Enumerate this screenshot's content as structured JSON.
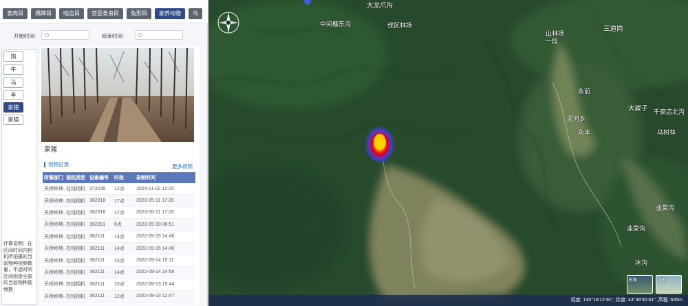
{
  "categories": {
    "tabs": [
      "食肉目",
      "偶蹄目",
      "啮齿目",
      "劳亚食虫目",
      "兔形目",
      "家养动物",
      "鸟"
    ],
    "active_index": 5
  },
  "filters": {
    "start_label": "开始时间:",
    "end_label": "结束时间:"
  },
  "animals": {
    "items": [
      "狗",
      "牛",
      "马",
      "羊",
      "家猪",
      "家猫"
    ],
    "active_index": 4
  },
  "calc_note": "计算说明：在区间时间内相机所拍摄的当前物种视频数量，不选时间区间则是全部的当前物种视频数",
  "detail": {
    "species_name": "家猪",
    "section_title": "视频记录",
    "more_link": "更多视频",
    "columns": [
      "所属部门",
      "相机类型",
      "设备编号",
      "时段",
      "录制时间"
    ],
    "rows": [
      {
        "dept": "天桥岭林...",
        "type": "在线相机",
        "device": "372035",
        "period": "12点",
        "time": "2024-11-02 12:00"
      },
      {
        "dept": "天桥岭林...",
        "type": "在线相机",
        "device": "382318",
        "period": "17点",
        "time": "2023-05-11 17:20"
      },
      {
        "dept": "天桥岭林...",
        "type": "在线相机",
        "device": "382318",
        "period": "17点",
        "time": "2023-05-11 17:20"
      },
      {
        "dept": "天桥岭林...",
        "type": "在线相机",
        "device": "382281",
        "period": "8点",
        "time": "2023-05-10 08:51"
      },
      {
        "dept": "天桥岭林...",
        "type": "在线相机",
        "device": "382111",
        "period": "14点",
        "time": "2022-09-15 14:48"
      },
      {
        "dept": "天桥岭林...",
        "type": "在线相机",
        "device": "382111",
        "period": "14点",
        "time": "2022-09-15 14:46"
      },
      {
        "dept": "天桥岭林...",
        "type": "在线相机",
        "device": "382111",
        "period": "15点",
        "time": "2022-09-14 15:11"
      },
      {
        "dept": "天桥岭林...",
        "type": "在线相机",
        "device": "382111",
        "period": "14点",
        "time": "2022-09-14 14:59"
      },
      {
        "dept": "天桥岭林...",
        "type": "在线相机",
        "device": "382111",
        "period": "15点",
        "time": "2022-09-13 15:44"
      },
      {
        "dept": "天桥岭林...",
        "type": "在线相机",
        "device": "382111",
        "period": "12点",
        "time": "2022-09-13 12:47"
      }
    ]
  },
  "map": {
    "places": [
      "大龙爪沟",
      "中间棚东沟",
      "伐区林场",
      "山林场一段",
      "三道岗",
      "永前",
      "大崴子",
      "千家店北沟",
      "泥河乡",
      "永丰",
      "马树林",
      "韭菜沟",
      "韭菜沟",
      "冰沟"
    ],
    "status_bar": "高程: 635m",
    "coordinates": "经度: 130°18'12.91\"; 纬度: 43°49'30.61\"; 高程: 635m",
    "globe_labels": [
      "影像",
      "地形"
    ]
  }
}
